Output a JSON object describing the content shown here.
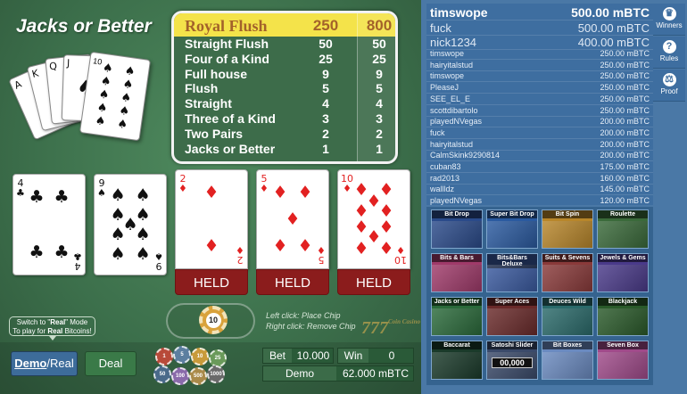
{
  "game": {
    "title": "Jacks or Better",
    "logo_card": {
      "rank": "10",
      "suit": "♠"
    },
    "paytable": [
      {
        "hand": "Royal Flush",
        "coin1": "250",
        "coin2": "800"
      },
      {
        "hand": "Straight Flush",
        "coin1": "50",
        "coin2": "50"
      },
      {
        "hand": "Four of a Kind",
        "coin1": "25",
        "coin2": "25"
      },
      {
        "hand": "Full house",
        "coin1": "9",
        "coin2": "9"
      },
      {
        "hand": "Flush",
        "coin1": "5",
        "coin2": "5"
      },
      {
        "hand": "Straight",
        "coin1": "4",
        "coin2": "4"
      },
      {
        "hand": "Three of a Kind",
        "coin1": "3",
        "coin2": "3"
      },
      {
        "hand": "Two Pairs",
        "coin1": "2",
        "coin2": "2"
      },
      {
        "hand": "Jacks or Better",
        "coin1": "1",
        "coin2": "1"
      }
    ],
    "cards": [
      {
        "rank": "4",
        "suit": "♣",
        "color": "blk",
        "held": false
      },
      {
        "rank": "9",
        "suit": "♠",
        "color": "blk",
        "held": false
      },
      {
        "rank": "2",
        "suit": "♦",
        "color": "red",
        "held": true
      },
      {
        "rank": "5",
        "suit": "♦",
        "color": "red",
        "held": true
      },
      {
        "rank": "10",
        "suit": "♦",
        "color": "red",
        "held": true
      }
    ],
    "held_label": "HELD",
    "chip_value": "10",
    "hint_left": "Left click: Place Chip",
    "hint_right": "Right click: Remove Chip",
    "switch_note_line1_pre": "Switch to \"",
    "switch_note_real": "Real",
    "switch_note_line1_post": "\" Mode",
    "switch_note_line2_pre": "To play for ",
    "switch_note_line2_post": " Bitcoins!",
    "demo_label": "Demo",
    "real_label": "/Real",
    "deal_label": "Deal",
    "bet_label": "Bet",
    "bet_value": "10.000",
    "win_label": "Win",
    "win_value": "0",
    "mode_label": "Demo",
    "balance": "62.000 mBTC",
    "watermark": "777",
    "watermark_small": "Coin Casino",
    "chip_stack": [
      {
        "v": "1",
        "color": "#b84a3a"
      },
      {
        "v": "5",
        "color": "#5c7fa0"
      },
      {
        "v": "10",
        "color": "#c89a3a"
      },
      {
        "v": "25",
        "color": "#6a9a5a"
      },
      {
        "v": "50",
        "color": "#4a6a8a"
      },
      {
        "v": "100",
        "color": "#8a6aaa"
      },
      {
        "v": "500",
        "color": "#aa8a4a"
      },
      {
        "v": "1000",
        "color": "#6a6a6a"
      }
    ]
  },
  "winners": [
    {
      "user": "timswope",
      "amount": "500.00 mBTC"
    },
    {
      "user": "fuck",
      "amount": "500.00 mBTC"
    },
    {
      "user": "nick1234",
      "amount": "400.00 mBTC"
    },
    {
      "user": "timswope",
      "amount": "250.00 mBTC"
    },
    {
      "user": "hairyitalstud",
      "amount": "250.00 mBTC"
    },
    {
      "user": "timswope",
      "amount": "250.00 mBTC"
    },
    {
      "user": "PleaseJ",
      "amount": "250.00 mBTC"
    },
    {
      "user": "SEE_EL_E",
      "amount": "250.00 mBTC"
    },
    {
      "user": "scottdibartolo",
      "amount": "250.00 mBTC"
    },
    {
      "user": "playedNVegas",
      "amount": "200.00 mBTC"
    },
    {
      "user": "fuck",
      "amount": "200.00 mBTC"
    },
    {
      "user": "hairyitalstud",
      "amount": "200.00 mBTC"
    },
    {
      "user": "CalmSkink9290814",
      "amount": "200.00 mBTC"
    },
    {
      "user": "cuban83",
      "amount": "175.00 mBTC"
    },
    {
      "user": "rad2013",
      "amount": "160.00 mBTC"
    },
    {
      "user": "wallldz",
      "amount": "145.00 mBTC"
    },
    {
      "user": "playedNVegas",
      "amount": "120.00 mBTC"
    }
  ],
  "side_menu": [
    {
      "label": "Winners",
      "icon": "trophy-icon",
      "glyph": "♛"
    },
    {
      "label": "Rules",
      "icon": "question-icon",
      "glyph": "?"
    },
    {
      "label": "Proof",
      "icon": "scales-icon",
      "glyph": "⚖"
    }
  ],
  "games_list": [
    {
      "title": "Bit Drop",
      "bg": "#2a4a8a"
    },
    {
      "title": "Super Bit Drop",
      "bg": "#2a5aa0"
    },
    {
      "title": "Bit Spin",
      "bg": "#b8862a"
    },
    {
      "title": "Roulette",
      "bg": "#3a6a3a"
    },
    {
      "title": "Bits & Bars",
      "bg": "#a03a6a"
    },
    {
      "title": "Bits&Bars Deluxe",
      "bg": "#3a5aa0"
    },
    {
      "title": "Suits & Sevens",
      "bg": "#8a3a3a"
    },
    {
      "title": "Jewels & Gems",
      "bg": "#4a3a8a"
    },
    {
      "title": "Jacks or Better",
      "bg": "#2a6a3a"
    },
    {
      "title": "Super Aces",
      "bg": "#6a2a2a"
    },
    {
      "title": "Deuces Wild",
      "bg": "#2a6a6a"
    },
    {
      "title": "Blackjack",
      "bg": "#2a5a2a"
    },
    {
      "title": "Baccarat",
      "bg": "#1a3a2a"
    },
    {
      "title": "Satoshi Slider",
      "bg": "#3a4a6a",
      "value": "00,000"
    },
    {
      "title": "Bit Boxes",
      "bg": "#6a8ac0"
    },
    {
      "title": "Seven Box",
      "bg": "#a04a8a"
    }
  ]
}
